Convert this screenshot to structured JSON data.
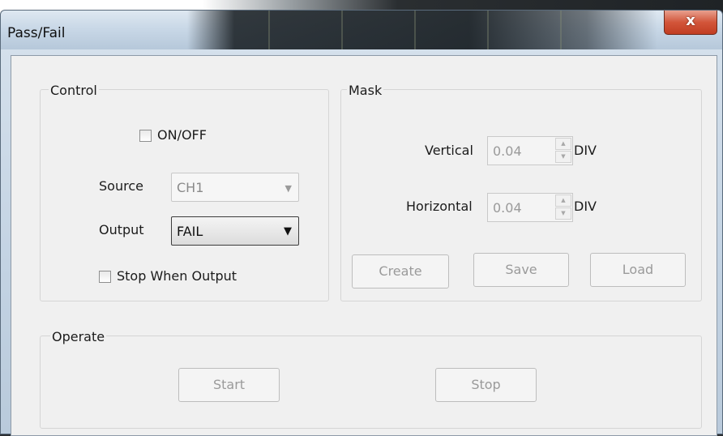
{
  "window": {
    "title": "Pass/Fail",
    "close_glyph": "x"
  },
  "control": {
    "label": "Control",
    "onoff_label": "ON/OFF",
    "onoff_checked": false,
    "source_label": "Source",
    "source_value": "CH1",
    "output_label": "Output",
    "output_value": "FAIL",
    "stop_label": "Stop When Output",
    "stop_checked": false
  },
  "mask": {
    "label": "Mask",
    "vertical_label": "Vertical",
    "vertical_value": "0.04",
    "vertical_unit": "DIV",
    "horizontal_label": "Horizontal",
    "horizontal_value": "0.04",
    "horizontal_unit": "DIV",
    "create_label": "Create",
    "save_label": "Save",
    "load_label": "Load"
  },
  "operate": {
    "label": "Operate",
    "start_label": "Start",
    "stop_label": "Stop"
  },
  "icons": {
    "close": "close-icon",
    "dropdown": "chevron-down-icon",
    "spin_up": "chevron-up-icon",
    "spin_down": "chevron-down-icon"
  }
}
